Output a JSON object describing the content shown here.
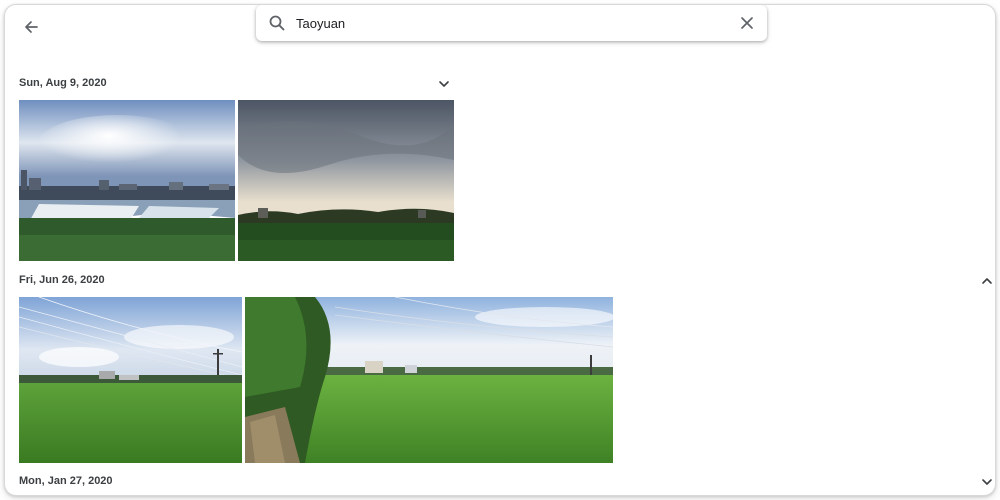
{
  "search": {
    "query": "Taoyuan"
  },
  "groups": [
    {
      "date": "Sun, Aug 9, 2020",
      "state": "expanded-down",
      "photos": [
        "city-skyline-with-flooded-fields",
        "overcast-sky-over-green-field"
      ]
    },
    {
      "date": "Fri, Jun 26, 2020",
      "state": "collapsible-up",
      "photos": [
        "rice-paddy-with-power-lines",
        "rice-paddy-with-trees-and-path"
      ]
    },
    {
      "date": "Mon, Jan 27, 2020",
      "state": "expanded-down",
      "photos": []
    }
  ],
  "icons": {
    "back": "arrow-left-icon",
    "search": "search-icon",
    "clear": "close-icon",
    "chevron_down": "chevron-down-icon",
    "chevron_up": "chevron-up-icon"
  },
  "colors": {
    "icon": "#5f6368",
    "text": "#3c4043"
  }
}
